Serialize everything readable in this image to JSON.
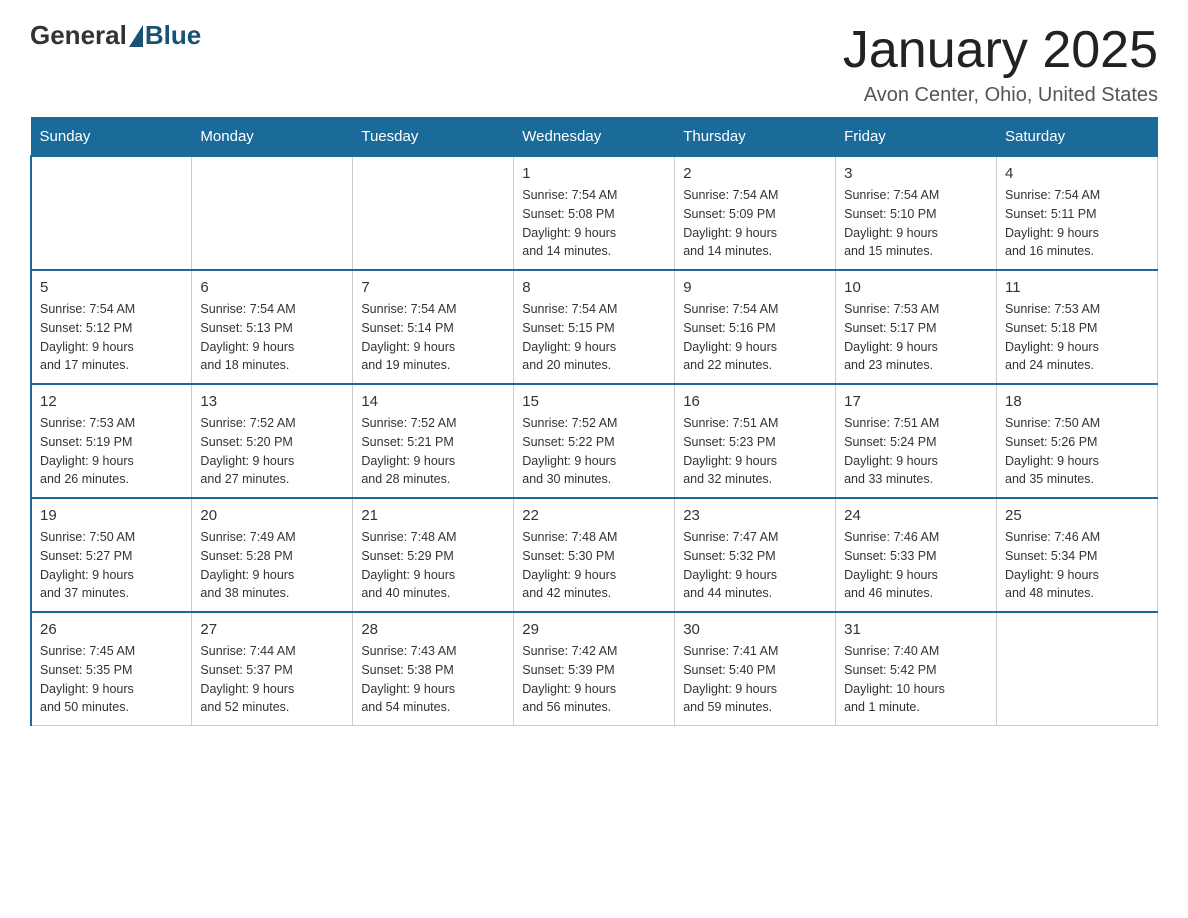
{
  "logo": {
    "general": "General",
    "blue": "Blue"
  },
  "title": "January 2025",
  "subtitle": "Avon Center, Ohio, United States",
  "days_of_week": [
    "Sunday",
    "Monday",
    "Tuesday",
    "Wednesday",
    "Thursday",
    "Friday",
    "Saturday"
  ],
  "weeks": [
    [
      {
        "day": "",
        "info": ""
      },
      {
        "day": "",
        "info": ""
      },
      {
        "day": "",
        "info": ""
      },
      {
        "day": "1",
        "info": "Sunrise: 7:54 AM\nSunset: 5:08 PM\nDaylight: 9 hours\nand 14 minutes."
      },
      {
        "day": "2",
        "info": "Sunrise: 7:54 AM\nSunset: 5:09 PM\nDaylight: 9 hours\nand 14 minutes."
      },
      {
        "day": "3",
        "info": "Sunrise: 7:54 AM\nSunset: 5:10 PM\nDaylight: 9 hours\nand 15 minutes."
      },
      {
        "day": "4",
        "info": "Sunrise: 7:54 AM\nSunset: 5:11 PM\nDaylight: 9 hours\nand 16 minutes."
      }
    ],
    [
      {
        "day": "5",
        "info": "Sunrise: 7:54 AM\nSunset: 5:12 PM\nDaylight: 9 hours\nand 17 minutes."
      },
      {
        "day": "6",
        "info": "Sunrise: 7:54 AM\nSunset: 5:13 PM\nDaylight: 9 hours\nand 18 minutes."
      },
      {
        "day": "7",
        "info": "Sunrise: 7:54 AM\nSunset: 5:14 PM\nDaylight: 9 hours\nand 19 minutes."
      },
      {
        "day": "8",
        "info": "Sunrise: 7:54 AM\nSunset: 5:15 PM\nDaylight: 9 hours\nand 20 minutes."
      },
      {
        "day": "9",
        "info": "Sunrise: 7:54 AM\nSunset: 5:16 PM\nDaylight: 9 hours\nand 22 minutes."
      },
      {
        "day": "10",
        "info": "Sunrise: 7:53 AM\nSunset: 5:17 PM\nDaylight: 9 hours\nand 23 minutes."
      },
      {
        "day": "11",
        "info": "Sunrise: 7:53 AM\nSunset: 5:18 PM\nDaylight: 9 hours\nand 24 minutes."
      }
    ],
    [
      {
        "day": "12",
        "info": "Sunrise: 7:53 AM\nSunset: 5:19 PM\nDaylight: 9 hours\nand 26 minutes."
      },
      {
        "day": "13",
        "info": "Sunrise: 7:52 AM\nSunset: 5:20 PM\nDaylight: 9 hours\nand 27 minutes."
      },
      {
        "day": "14",
        "info": "Sunrise: 7:52 AM\nSunset: 5:21 PM\nDaylight: 9 hours\nand 28 minutes."
      },
      {
        "day": "15",
        "info": "Sunrise: 7:52 AM\nSunset: 5:22 PM\nDaylight: 9 hours\nand 30 minutes."
      },
      {
        "day": "16",
        "info": "Sunrise: 7:51 AM\nSunset: 5:23 PM\nDaylight: 9 hours\nand 32 minutes."
      },
      {
        "day": "17",
        "info": "Sunrise: 7:51 AM\nSunset: 5:24 PM\nDaylight: 9 hours\nand 33 minutes."
      },
      {
        "day": "18",
        "info": "Sunrise: 7:50 AM\nSunset: 5:26 PM\nDaylight: 9 hours\nand 35 minutes."
      }
    ],
    [
      {
        "day": "19",
        "info": "Sunrise: 7:50 AM\nSunset: 5:27 PM\nDaylight: 9 hours\nand 37 minutes."
      },
      {
        "day": "20",
        "info": "Sunrise: 7:49 AM\nSunset: 5:28 PM\nDaylight: 9 hours\nand 38 minutes."
      },
      {
        "day": "21",
        "info": "Sunrise: 7:48 AM\nSunset: 5:29 PM\nDaylight: 9 hours\nand 40 minutes."
      },
      {
        "day": "22",
        "info": "Sunrise: 7:48 AM\nSunset: 5:30 PM\nDaylight: 9 hours\nand 42 minutes."
      },
      {
        "day": "23",
        "info": "Sunrise: 7:47 AM\nSunset: 5:32 PM\nDaylight: 9 hours\nand 44 minutes."
      },
      {
        "day": "24",
        "info": "Sunrise: 7:46 AM\nSunset: 5:33 PM\nDaylight: 9 hours\nand 46 minutes."
      },
      {
        "day": "25",
        "info": "Sunrise: 7:46 AM\nSunset: 5:34 PM\nDaylight: 9 hours\nand 48 minutes."
      }
    ],
    [
      {
        "day": "26",
        "info": "Sunrise: 7:45 AM\nSunset: 5:35 PM\nDaylight: 9 hours\nand 50 minutes."
      },
      {
        "day": "27",
        "info": "Sunrise: 7:44 AM\nSunset: 5:37 PM\nDaylight: 9 hours\nand 52 minutes."
      },
      {
        "day": "28",
        "info": "Sunrise: 7:43 AM\nSunset: 5:38 PM\nDaylight: 9 hours\nand 54 minutes."
      },
      {
        "day": "29",
        "info": "Sunrise: 7:42 AM\nSunset: 5:39 PM\nDaylight: 9 hours\nand 56 minutes."
      },
      {
        "day": "30",
        "info": "Sunrise: 7:41 AM\nSunset: 5:40 PM\nDaylight: 9 hours\nand 59 minutes."
      },
      {
        "day": "31",
        "info": "Sunrise: 7:40 AM\nSunset: 5:42 PM\nDaylight: 10 hours\nand 1 minute."
      },
      {
        "day": "",
        "info": ""
      }
    ]
  ]
}
